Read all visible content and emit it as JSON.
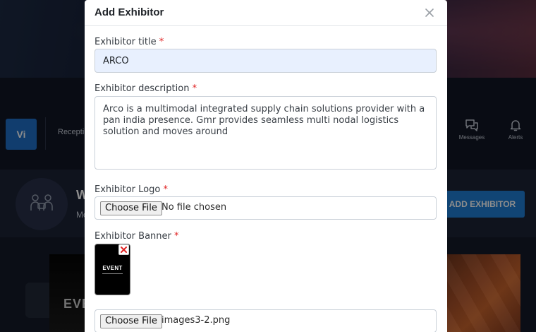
{
  "background": {
    "logo_text": "Vi",
    "nav_item": "Recepti",
    "messages_label": "Messages",
    "alerts_label": "Alerts",
    "heading_partial": "W",
    "subtext_partial": "Mo",
    "add_exhibitor_button": "ADD EXHIBITOR",
    "event_partial": "EVE"
  },
  "modal": {
    "title": "Add Exhibitor",
    "fields": {
      "title": {
        "label": "Exhibitor title",
        "required": "*",
        "value": "ARCO"
      },
      "description": {
        "label": "Exhibitor description",
        "required": "*",
        "value": "Arco is a multimodal integrated supply chain solutions provider with a pan india presence. Gmr provides seamless multi nodal logistics solution and moves around"
      },
      "logo": {
        "label": "Exhibitor Logo",
        "required": "*",
        "button": "Choose File",
        "status": "No file chosen"
      },
      "banner": {
        "label": "Exhibitor Banner",
        "required": "*",
        "thumb_text": "EVENT",
        "button": "Choose File",
        "status": "images3-2.png"
      }
    }
  },
  "colors": {
    "primary": "#1f7fd6",
    "required": "#e02424",
    "autofill_bg": "#e8f0fe"
  }
}
